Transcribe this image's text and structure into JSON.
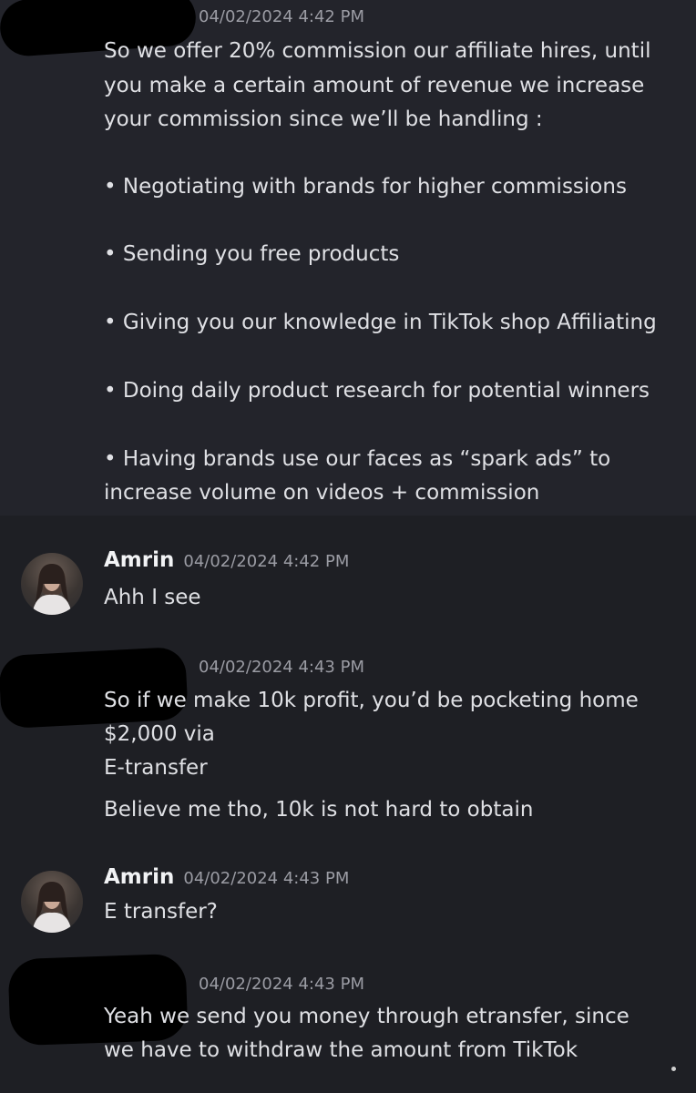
{
  "messages": [
    {
      "author": "",
      "timestamp": "04/02/2024 4:42 PM",
      "lines": [
        "So we offer 20% commission our affiliate hires, until",
        "you make a certain amount of revenue we increase",
        "your commission since we’ll be handling :",
        "• Negotiating with brands for higher commissions",
        "• Sending you free products",
        "• Giving you our knowledge in TikTok shop Affiliating",
        "• Doing daily product research for potential winners",
        "• Having brands use our faces as “spark ads” to",
        "increase volume on videos + commission"
      ]
    },
    {
      "author": "Amrin",
      "timestamp": "04/02/2024 4:42 PM",
      "lines": [
        "Ahh I see"
      ]
    },
    {
      "author": "",
      "timestamp": "04/02/2024 4:43 PM",
      "lines": [
        "So if we make 10k profit, you’d be pocketing home",
        "$2,000 via",
        " E-transfer",
        "Believe me tho, 10k is not hard to obtain"
      ]
    },
    {
      "author": "Amrin",
      "timestamp": "04/02/2024 4:43 PM",
      "lines": [
        "E transfer?"
      ]
    },
    {
      "author": "",
      "timestamp": "04/02/2024 4:43 PM",
      "lines": [
        "Yeah we send you money through etransfer, since",
        "we have to withdraw the amount from TikTok"
      ]
    }
  ],
  "colors": {
    "background": "#1e1f24",
    "highlight_band": "#23242b",
    "text": "#dfe0e4",
    "timestamp": "#9b9ca4",
    "author": "#f2f3f5"
  }
}
